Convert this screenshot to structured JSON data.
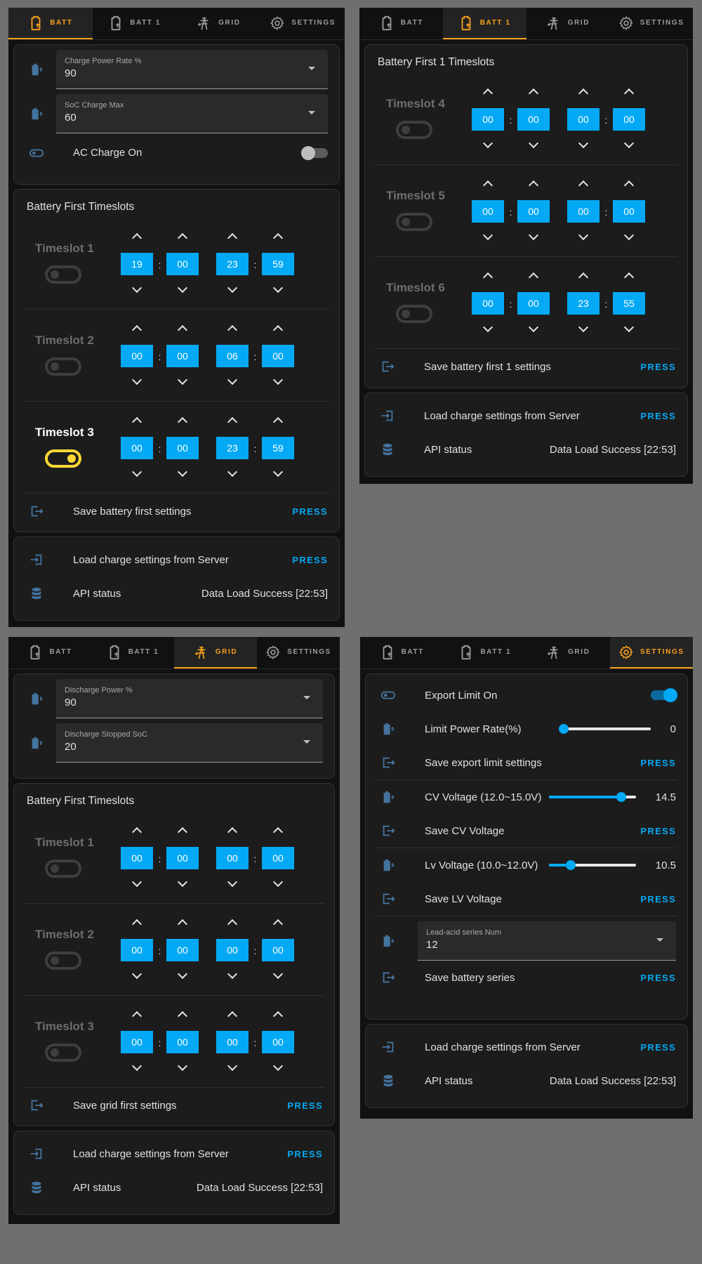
{
  "tabs": [
    "BATT",
    "BATT 1",
    "GRID",
    "SETTINGS"
  ],
  "press_label": "PRESS",
  "colon": ":",
  "common": {
    "load_label": "Load charge settings from Server",
    "api_label": "API status",
    "api_value": "Data Load Success [22:53]"
  },
  "batt": {
    "charge_power": {
      "label": "Charge Power Rate %",
      "value": "90"
    },
    "soc_max": {
      "label": "SoC Charge Max",
      "value": "60"
    },
    "ac_charge_label": "AC Charge On",
    "ac_charge_on": false,
    "timeslots_title": "Battery First Timeslots",
    "slots": [
      {
        "name": "Timeslot 1",
        "enabled": false,
        "start_h": "19",
        "start_m": "00",
        "end_h": "23",
        "end_m": "59"
      },
      {
        "name": "Timeslot 2",
        "enabled": false,
        "start_h": "00",
        "start_m": "00",
        "end_h": "06",
        "end_m": "00"
      },
      {
        "name": "Timeslot 3",
        "enabled": true,
        "start_h": "00",
        "start_m": "00",
        "end_h": "23",
        "end_m": "59"
      }
    ],
    "save_label": "Save battery first settings"
  },
  "batt1": {
    "timeslots_title": "Battery First 1 Timeslots",
    "slots": [
      {
        "name": "Timeslot 4",
        "enabled": false,
        "start_h": "00",
        "start_m": "00",
        "end_h": "00",
        "end_m": "00"
      },
      {
        "name": "Timeslot 5",
        "enabled": false,
        "start_h": "00",
        "start_m": "00",
        "end_h": "00",
        "end_m": "00"
      },
      {
        "name": "Timeslot 6",
        "enabled": false,
        "start_h": "00",
        "start_m": "00",
        "end_h": "23",
        "end_m": "55"
      }
    ],
    "save_label": "Save battery first 1 settings"
  },
  "grid": {
    "discharge_power": {
      "label": "Discharge Power %",
      "value": "90"
    },
    "discharge_soc": {
      "label": "Discharge Stopped SoC",
      "value": "20"
    },
    "timeslots_title": "Battery First Timeslots",
    "slots": [
      {
        "name": "Timeslot 1",
        "enabled": false,
        "start_h": "00",
        "start_m": "00",
        "end_h": "00",
        "end_m": "00"
      },
      {
        "name": "Timeslot 2",
        "enabled": false,
        "start_h": "00",
        "start_m": "00",
        "end_h": "00",
        "end_m": "00"
      },
      {
        "name": "Timeslot 3",
        "enabled": false,
        "start_h": "00",
        "start_m": "00",
        "end_h": "00",
        "end_m": "00"
      }
    ],
    "save_label": "Save grid first settings"
  },
  "settings": {
    "export_limit_label": "Export Limit On",
    "export_limit_on": true,
    "limit_power_label": "Limit Power Rate(%)",
    "limit_power_value": "0",
    "limit_power_fraction": 0.0,
    "save_export_label": "Save export limit settings",
    "cv_label": "CV Voltage (12.0~15.0V)",
    "cv_value": "14.5",
    "cv_fraction": 0.833,
    "save_cv_label": "Save CV Voltage",
    "lv_label": "Lv Voltage (10.0~12.0V)",
    "lv_value": "10.5",
    "lv_fraction": 0.25,
    "save_lv_label": "Save LV Voltage",
    "series": {
      "label": "Lead-acid series Num",
      "value": "12"
    },
    "save_series_label": "Save battery series"
  },
  "colors": {
    "accent": "#03a9f4",
    "active_tab": "#f9a11b",
    "toggle_on": "#fdd835",
    "icon": "#44739e"
  }
}
